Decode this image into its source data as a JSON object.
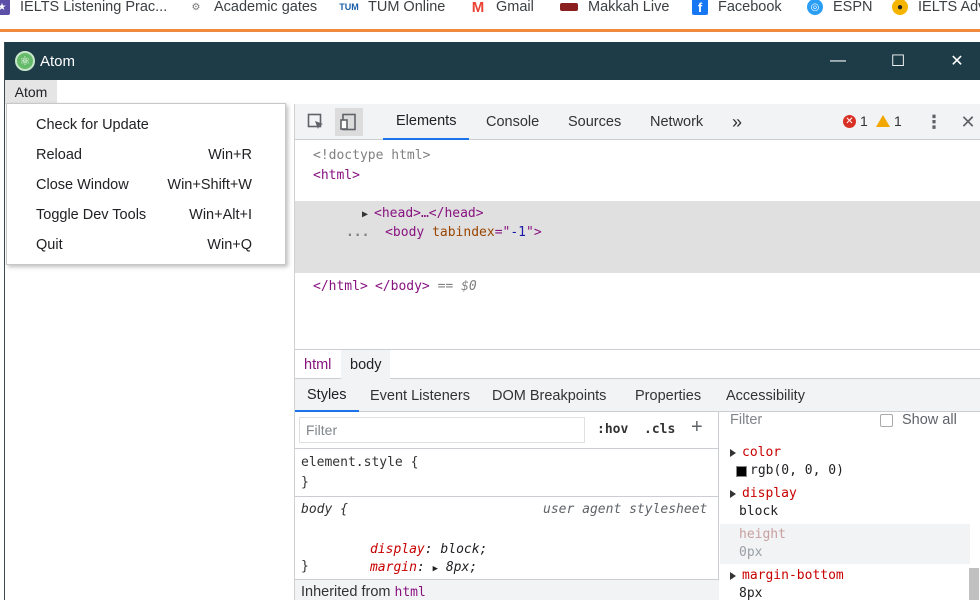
{
  "bookmarks": [
    {
      "label": "IELTS Listening Prac..."
    },
    {
      "label": "Academic gates"
    },
    {
      "label": "TUM Online",
      "icon_text": "TUM"
    },
    {
      "label": "Gmail",
      "icon_text": "M"
    },
    {
      "label": "Makkah Live"
    },
    {
      "label": "Facebook",
      "icon_text": "f"
    },
    {
      "label": "ESPN"
    },
    {
      "label": "IELTS Adv..."
    }
  ],
  "window": {
    "title": "Atom",
    "controls": {
      "minimize": "—",
      "maximize": "☐",
      "close": "✕"
    }
  },
  "menubar": {
    "atom_label": "Atom"
  },
  "menu": {
    "items": [
      {
        "label": "Check for Update",
        "shortcut": ""
      },
      {
        "label": "Reload",
        "shortcut": "Win+R"
      },
      {
        "label": "Close Window",
        "shortcut": "Win+Shift+W"
      },
      {
        "label": "Toggle Dev Tools",
        "shortcut": "Win+Alt+I"
      },
      {
        "label": "Quit",
        "shortcut": "Win+Q"
      }
    ]
  },
  "devtools": {
    "tabs": [
      "Elements",
      "Console",
      "Sources",
      "Network",
      "»"
    ],
    "active_tab": "Elements",
    "error_count": "1",
    "warning_count": "1",
    "dom": {
      "doctype": "<!doctype html>",
      "html_open": "<html>",
      "head": "<head>…</head>",
      "ellipsis": "...",
      "body_open_tag": "<body",
      "body_attr": " tabindex",
      "body_eq": "=\"",
      "body_attr_val": "-1",
      "body_close_bracket": "\">",
      "body_close": "</body>",
      "body_eq_sign": " == ",
      "body_ref": "$0",
      "html_close": "</html>"
    },
    "breadcrumbs": [
      "html",
      "body"
    ],
    "sub_tabs": [
      "Styles",
      "Event Listeners",
      "DOM Breakpoints",
      "Properties",
      "Accessibility"
    ],
    "active_sub_tab": "Styles",
    "styles": {
      "filter_placeholder": "Filter",
      "hov": ":hov",
      "cls": ".cls",
      "plus": "+",
      "element_style": "element.style {",
      "close_brace": "}",
      "body_selector": "body {",
      "source": "user agent stylesheet",
      "rules": [
        {
          "prop": "display",
          "value": " block;"
        },
        {
          "prop": "margin",
          "value": " 8px;"
        }
      ],
      "inherited_label": "Inherited from ",
      "inherited_tag": "html"
    },
    "computed": {
      "filter_placeholder": "Filter",
      "show_all": "Show all",
      "rows": [
        {
          "name": "color",
          "value": "rgb(0, 0, 0)",
          "swatch": "#000000",
          "inherited": false
        },
        {
          "name": "display",
          "value": "block",
          "inherited": false
        },
        {
          "name": "height",
          "value": "0px",
          "inherited": true
        },
        {
          "name": "margin-bottom",
          "value": "8px",
          "inherited": false
        }
      ]
    }
  }
}
